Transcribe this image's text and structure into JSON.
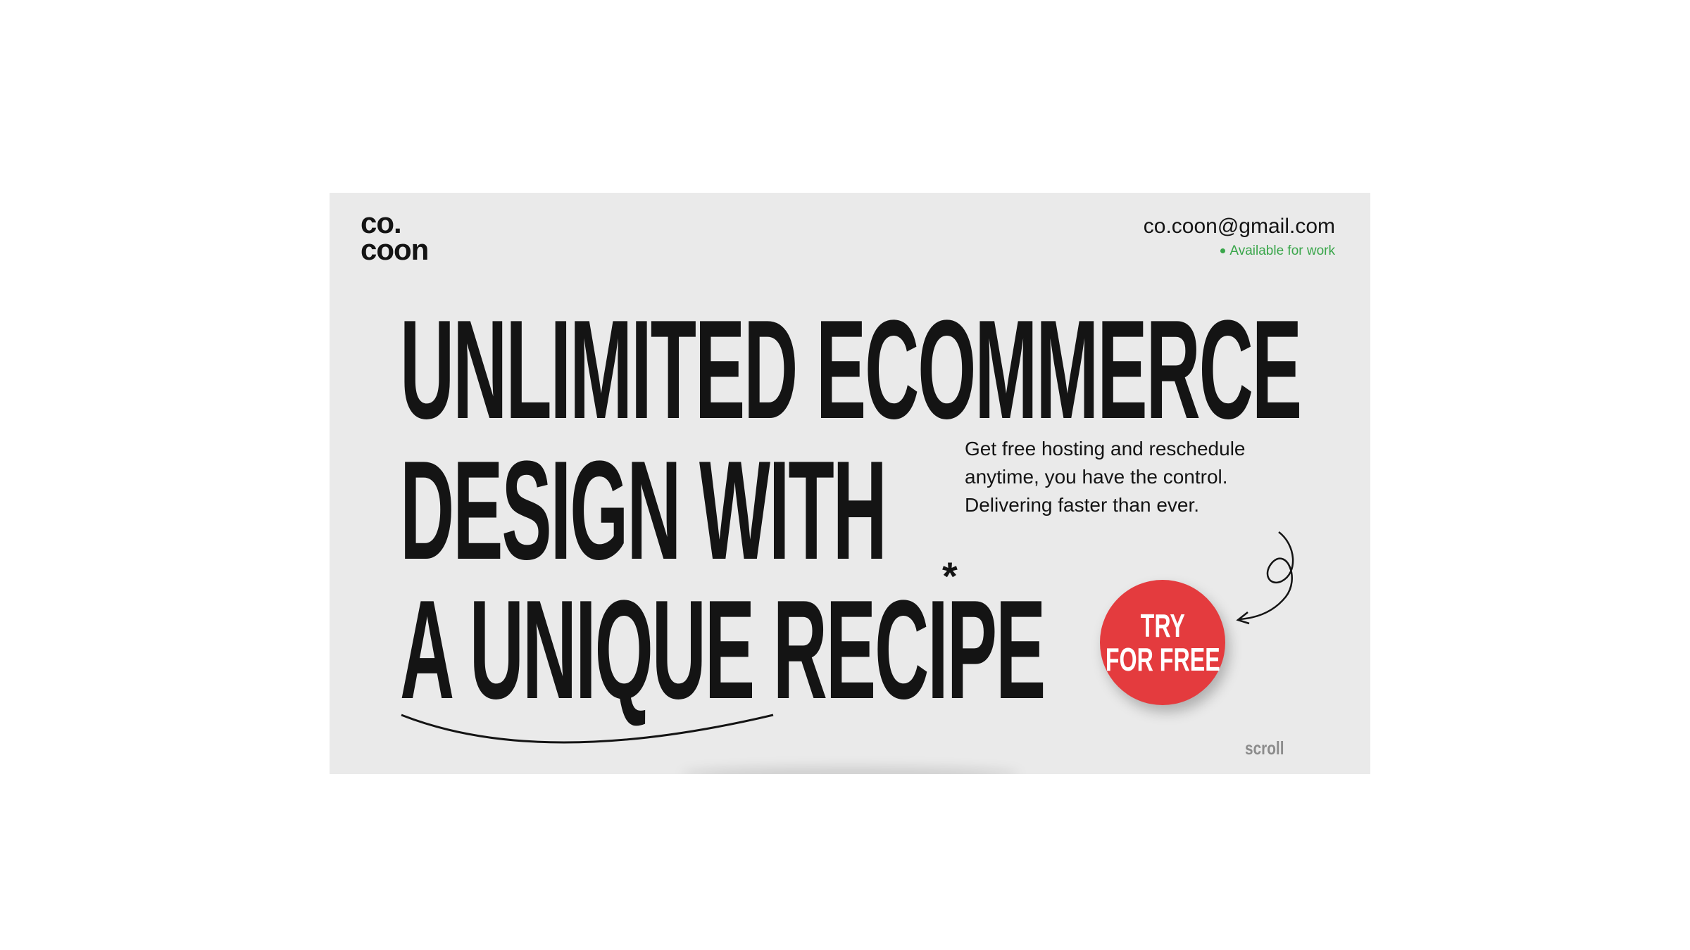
{
  "brand": {
    "logo_line1": "co.",
    "logo_line2": "coon"
  },
  "contact": {
    "email": "co.coon@gmail.com",
    "availability": "Available for work"
  },
  "hero": {
    "headline_line1": "UNLIMITED ECOMMERCE",
    "headline_line2": "DESIGN WITH",
    "headline_line3": "A UNIQUE RECIPE",
    "asterisk": "*",
    "tagline_line1": "Get free hosting and reschedule",
    "tagline_line2": "anytime, you have the control.",
    "tagline_line3": "Delivering faster than ever."
  },
  "cta": {
    "line1": "TRY",
    "line2": "FOR FREE"
  },
  "scroll": {
    "label": "scroll"
  },
  "colors": {
    "card_background": "#eaeaea",
    "text": "#141414",
    "accent_red": "#e43b3e",
    "available_green": "#3aa64b",
    "muted": "#8c8c8c"
  }
}
